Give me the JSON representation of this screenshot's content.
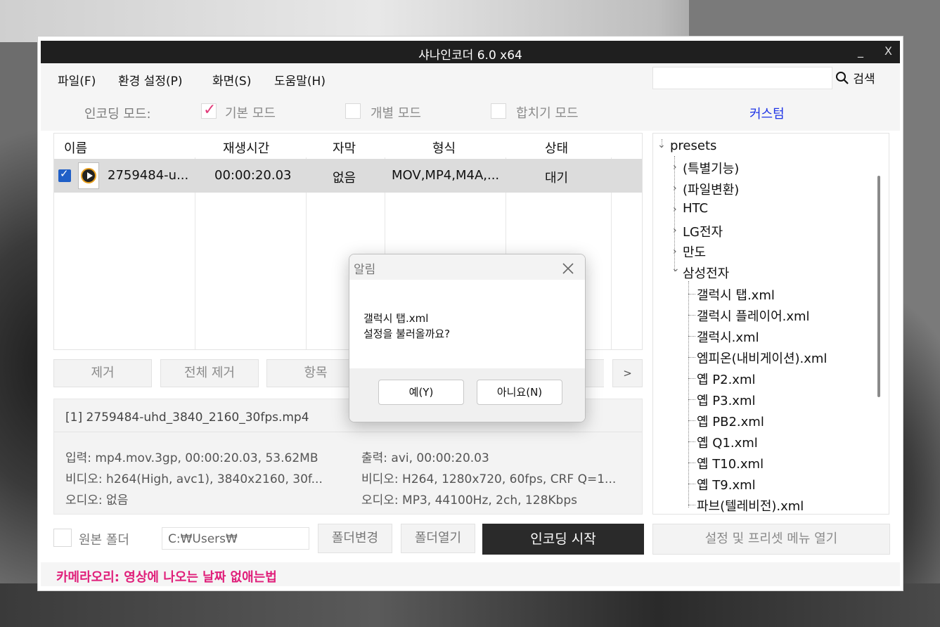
{
  "window": {
    "title": "샤나인코더 6.0 x64",
    "minimize": "_",
    "close": "X"
  },
  "menu": {
    "items": [
      "파일(F)",
      "환경 설정(P)",
      "화면(S)",
      "도움말(H)"
    ],
    "search_label": "검색",
    "search_value": ""
  },
  "mode": {
    "label": "인코딩 모드:",
    "basic": "기본 모드",
    "individual": "개별 모드",
    "merge": "합치기 모드",
    "custom": "커스텀"
  },
  "table": {
    "headers": [
      "이름",
      "재생시간",
      "자막",
      "형식",
      "상태"
    ],
    "rows": [
      {
        "name": "2759484-u...",
        "duration": "00:00:20.03",
        "subtitle": "없음",
        "format": "MOV,MP4,M4A,...",
        "status": "대기"
      }
    ]
  },
  "actions": {
    "remove": "제거",
    "remove_all": "전체 제거",
    "item": "항목",
    "more": ">"
  },
  "info": {
    "header": "[1] 2759484-uhd_3840_2160_30fps.mp4",
    "input": "입력: mp4.mov.3gp, 00:00:20.03, 53.62MB",
    "input_video": "비디오: h264(High, avc1), 3840x2160, 30f...",
    "input_audio": "오디오: 없음",
    "output": "출력: avi, 00:00:20.03",
    "output_video": "비디오: H264, 1280x720, 60fps, CRF Q=1...",
    "output_audio": "오디오: MP3, 44100Hz, 2ch, 128Kbps"
  },
  "tree": {
    "root": "presets",
    "folders": [
      "(특별기능)",
      "(파일변환)",
      "HTC",
      "LG전자",
      "만도"
    ],
    "expanded": "삼성전자",
    "files": [
      "갤럭시 탭.xml",
      "갤럭시 플레이어.xml",
      "갤럭시.xml",
      "엠피온(내비게이션).xml",
      "옙 P2.xml",
      "옙 P3.xml",
      "옙 PB2.xml",
      "옙 Q1.xml",
      "옙 T10.xml",
      "옙 T9.xml",
      "파브(텔레비전).xml"
    ]
  },
  "bottom": {
    "source_folder": "원본 폴더",
    "path": "C:₩Users₩",
    "change_folder": "폴더변경",
    "open_folder": "폴더열기",
    "start": "인코딩 시작",
    "preset_menu": "설정 및 프리셋 메뉴 열기"
  },
  "status_text": "카메라오리: 영상에 나오는 날짜 없애는법",
  "dialog": {
    "title": "알림",
    "line1": "갤럭시 탭.xml",
    "line2": "설정을 불러올까요?",
    "yes": "예(Y)",
    "no": "아니요(N)"
  },
  "colors": {
    "accent_pink": "#e01f7a",
    "link_blue": "#1e34e6",
    "titlebar": "#1f1f1f",
    "start_button": "#2a2a2a"
  }
}
